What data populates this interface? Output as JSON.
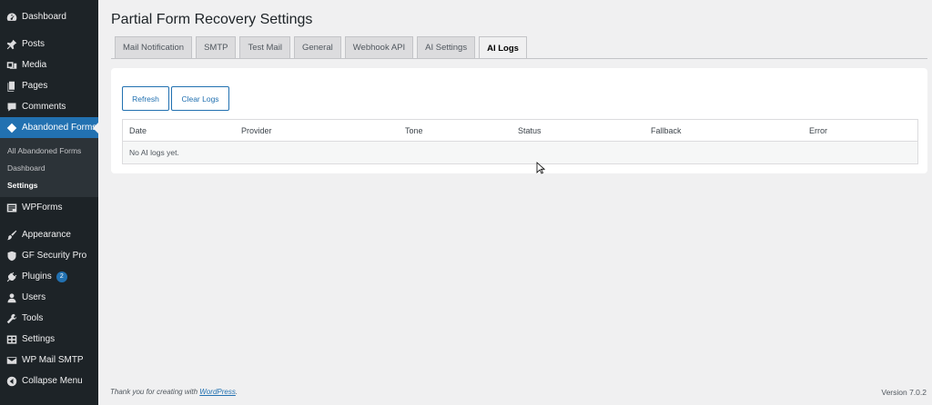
{
  "sidebar": {
    "top_items": [
      {
        "label": "Dashboard",
        "icon": "dashboard-icon"
      },
      {
        "label": "Posts",
        "icon": "pin-icon"
      },
      {
        "label": "Media",
        "icon": "media-icon"
      },
      {
        "label": "Pages",
        "icon": "pages-icon"
      },
      {
        "label": "Comments",
        "icon": "comment-icon"
      },
      {
        "label": "Abandoned Forms",
        "icon": "diamond-icon"
      }
    ],
    "submenu": [
      {
        "label": "All Abandoned Forms"
      },
      {
        "label": "Dashboard"
      },
      {
        "label": "Settings"
      }
    ],
    "bottom_items": [
      {
        "label": "WPForms",
        "icon": "form-icon"
      },
      {
        "label": "Appearance",
        "icon": "brush-icon"
      },
      {
        "label": "GF Security Pro",
        "icon": "shield-icon"
      },
      {
        "label": "Plugins",
        "icon": "plugin-icon",
        "badge": "2"
      },
      {
        "label": "Users",
        "icon": "user-icon"
      },
      {
        "label": "Tools",
        "icon": "wrench-icon"
      },
      {
        "label": "Settings",
        "icon": "settings-icon"
      },
      {
        "label": "WP Mail SMTP",
        "icon": "mail-icon"
      },
      {
        "label": "Collapse Menu",
        "icon": "collapse-icon"
      }
    ]
  },
  "page": {
    "title": "Partial Form Recovery Settings"
  },
  "tabs": [
    {
      "label": "Mail Notification"
    },
    {
      "label": "SMTP"
    },
    {
      "label": "Test Mail"
    },
    {
      "label": "General"
    },
    {
      "label": "Webhook API"
    },
    {
      "label": "AI Settings"
    },
    {
      "label": "AI Logs"
    }
  ],
  "buttons": {
    "refresh": "Refresh",
    "clear": "Clear Logs"
  },
  "table": {
    "columns": [
      "Date",
      "Provider",
      "Tone",
      "Status",
      "Fallback",
      "Error"
    ],
    "empty_message": "No AI logs yet."
  },
  "footer": {
    "thanks_prefix": "Thank you for creating with ",
    "thanks_link": "WordPress",
    "thanks_suffix": ".",
    "version": "Version 7.0.2"
  },
  "colors": {
    "sidebar_bg": "#1d2327",
    "accent": "#2271b1",
    "page_bg": "#f0f0f1"
  }
}
